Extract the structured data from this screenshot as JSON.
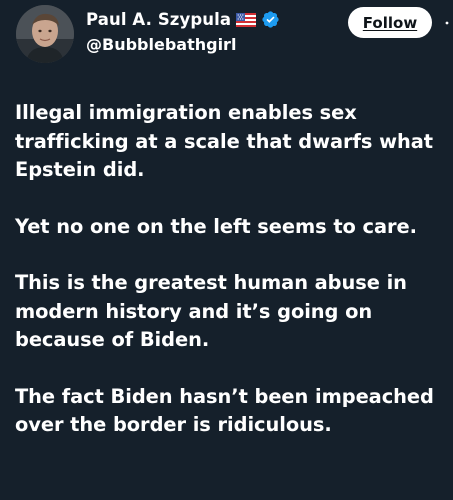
{
  "author": {
    "display_name": "Paul A. Szypula",
    "handle": "@Bubblebathgirl",
    "flag_icon": "us-flag-icon",
    "verified_icon": "verified-badge-icon",
    "verified_color": "#1d9bf0"
  },
  "actions": {
    "follow_label": "Follow",
    "more_icon": "more-options-icon"
  },
  "tweet": {
    "paragraphs": [
      "Illegal immigration enables sex\ntrafficking at a scale that dwarfs what\nEpstein did.",
      "Yet no one on the left seems to care.",
      "This is the greatest human abuse in\nmodern history and it’s going on\nbecause of Biden.",
      "The fact Biden hasn’t been impeached\nover the border is ridiculous."
    ]
  },
  "colors": {
    "background": "#15202b",
    "text": "#ffffff",
    "follow_button_bg": "#ffffff",
    "follow_button_text": "#0f1419"
  }
}
